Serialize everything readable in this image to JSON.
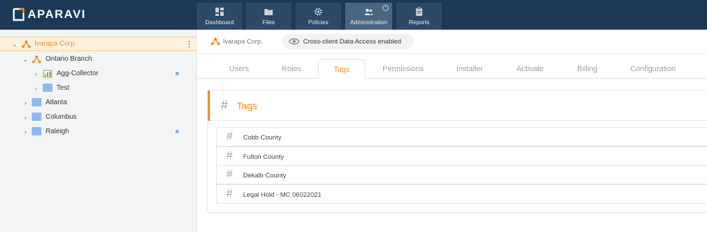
{
  "app": {
    "logo_text": "APARAVI",
    "brand_color": "#f28c1e",
    "topbar_color": "#1c3a57"
  },
  "nav": {
    "items": [
      {
        "label": "Dashboard",
        "icon": "dashboard-icon"
      },
      {
        "label": "Files",
        "icon": "folder-icon"
      },
      {
        "label": "Policies",
        "icon": "gear-icon"
      },
      {
        "label": "Administration",
        "icon": "users-icon",
        "active": true,
        "badge_icon": "info-icon"
      },
      {
        "label": "Reports",
        "icon": "clipboard-icon"
      }
    ]
  },
  "sidebar": {
    "tree": [
      {
        "label": "Ivarapa Corp.",
        "icon": "network-icon",
        "expanded": true,
        "selected": true,
        "menu_icon": "kebab-icon"
      },
      {
        "label": "Ontario Branch",
        "icon": "network-icon",
        "expanded": true
      },
      {
        "label": "Agg-Collector",
        "icon": "collector-icon",
        "status_dot": true
      },
      {
        "label": "Test",
        "icon": "folder-icon"
      },
      {
        "label": "Atlanta",
        "icon": "folder-icon"
      },
      {
        "label": "Columbus",
        "icon": "folder-icon"
      },
      {
        "label": "Raleigh",
        "icon": "folder-icon",
        "status_dot": true
      }
    ]
  },
  "header": {
    "client_name": "Ivarapa Corp.",
    "cross_client_label": "Cross-client Data Access enabled",
    "cross_client_icon": "eye-icon"
  },
  "tabs": {
    "items": [
      "Users",
      "Roles",
      "Tags",
      "Permissions",
      "Installer",
      "Activate",
      "Billing",
      "Configuration"
    ],
    "active": "Tags"
  },
  "tags_panel": {
    "title": "Tags",
    "hash_symbol": "#",
    "items": [
      "Cobb County",
      "Fulton County",
      "Dekalb County",
      "Legal Hold - MC 06022021"
    ]
  }
}
